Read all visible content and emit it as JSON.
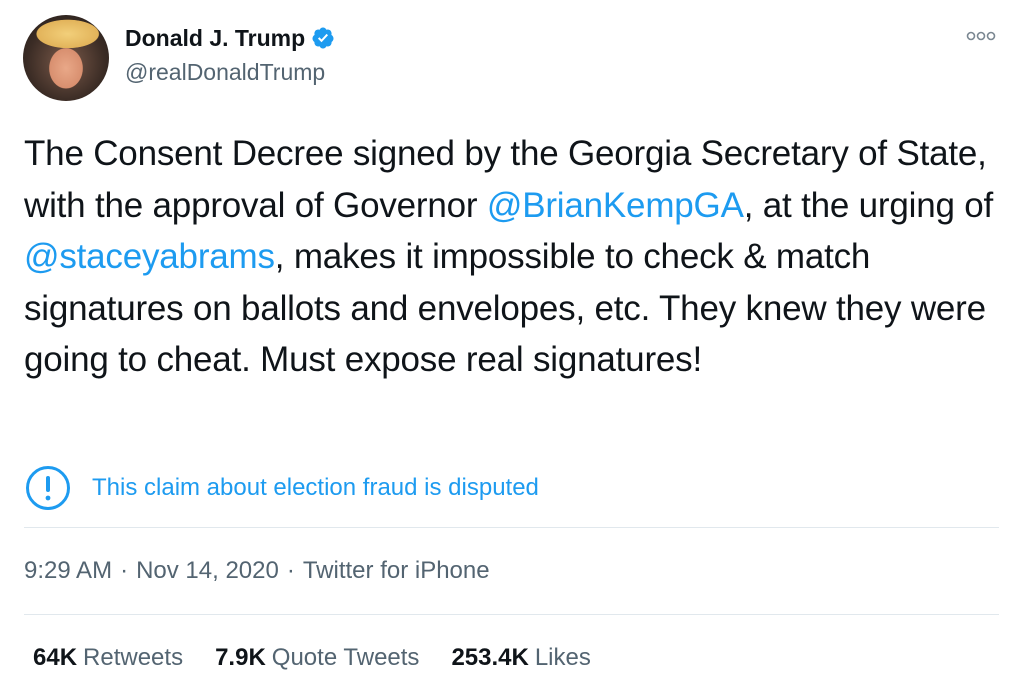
{
  "author": {
    "display_name": "Donald J. Trump",
    "handle": "@realDonaldTrump",
    "verified": true
  },
  "icons": {
    "verified": "verified-badge-icon",
    "more": "more-options-icon",
    "notice": "info-exclamation-icon"
  },
  "tweet": {
    "text_parts": [
      "The Consent Decree signed by the Georgia Secretary of State, with the approval of Governor ",
      "@BrianKempGA",
      ", at the urging of ",
      "@staceyabrams",
      ", makes it impossible to check & match signatures on ballots and envelopes, etc. They knew they were going to cheat. Must expose real signatures!"
    ]
  },
  "notice": {
    "text": "This claim about election fraud is disputed"
  },
  "meta": {
    "time": "9:29 AM",
    "separator": "·",
    "date": "Nov 14, 2020",
    "source": "Twitter for iPhone"
  },
  "stats": {
    "retweets_count": "64K",
    "retweets_label": "Retweets",
    "quote_count": "7.9K",
    "quote_label": "Quote Tweets",
    "likes_count": "253.4K",
    "likes_label": "Likes"
  },
  "colors": {
    "accent": "#1d9bf0",
    "text": "#0f1419",
    "secondary": "#536471",
    "divider": "#e1e8ed"
  }
}
